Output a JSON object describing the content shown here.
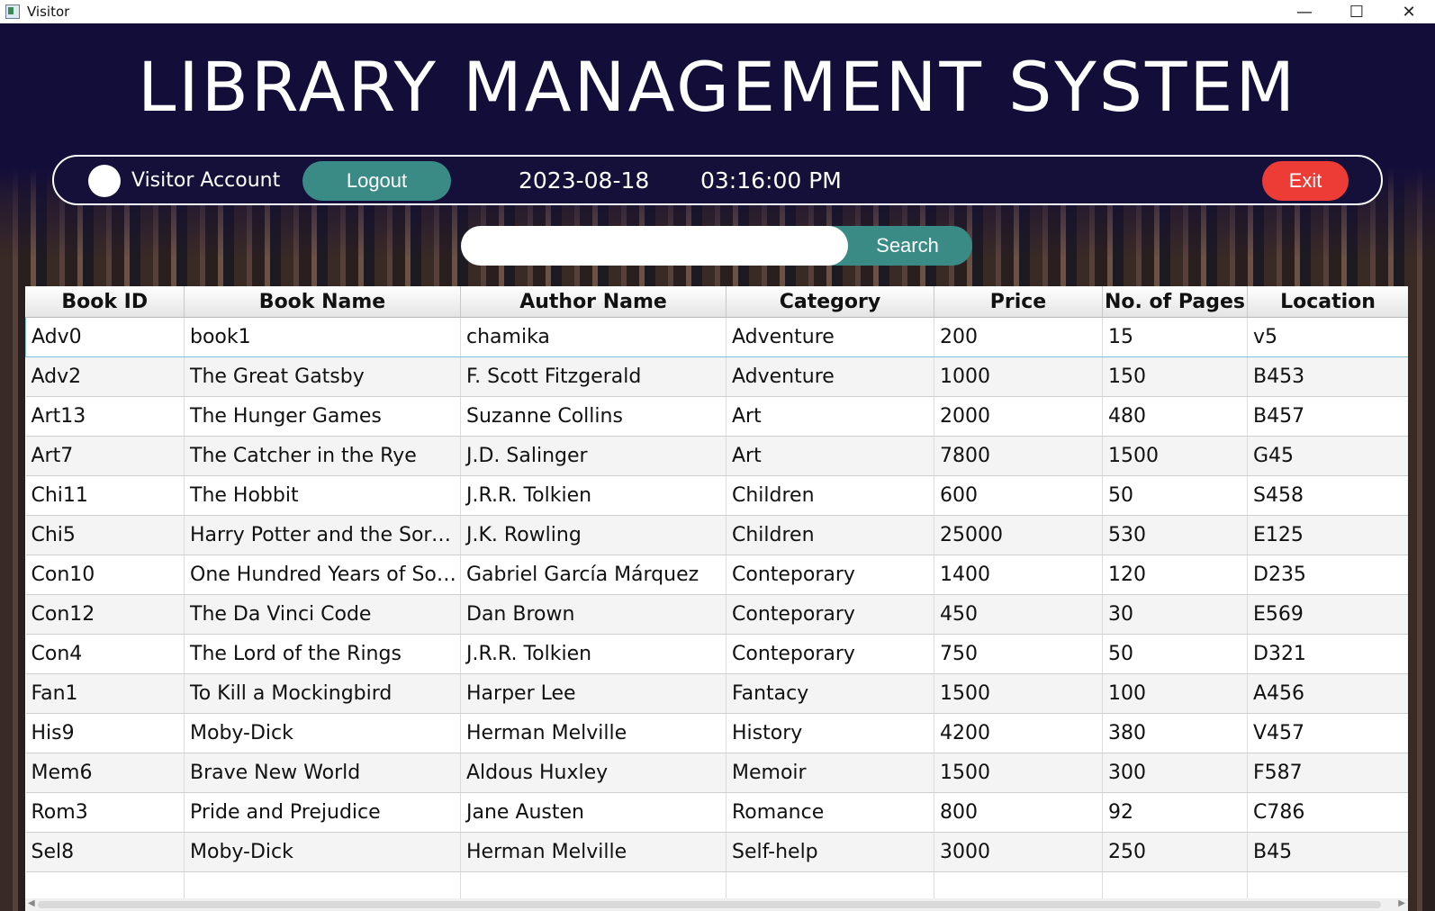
{
  "window": {
    "title": "Visitor",
    "controls": [
      "—",
      "☐",
      "✕"
    ]
  },
  "header": {
    "title": "LIBRARY MANAGEMENT SYSTEM"
  },
  "topbar": {
    "account_label": "Visitor Account",
    "logout_label": "Logout",
    "date": "2023-08-18",
    "time": "03:16:00 PM",
    "exit_label": "Exit"
  },
  "search": {
    "value": "",
    "button_label": "Search"
  },
  "colors": {
    "header_bg": "#15103a",
    "teal": "#3a8b86",
    "exit_red": "#ed3b36"
  },
  "table": {
    "columns": [
      "Book ID",
      "Book Name",
      "Author Name",
      "Category",
      "Price",
      "No. of Pages",
      "Location"
    ],
    "rows": [
      [
        "Adv0",
        "book1",
        "chamika",
        "Adventure",
        "200",
        "15",
        "v5"
      ],
      [
        "Adv2",
        "The Great Gatsby",
        "F. Scott Fitzgerald",
        "Adventure",
        "1000",
        "150",
        "B453"
      ],
      [
        "Art13",
        "The Hunger Games",
        " Suzanne Collins",
        "Art",
        "2000",
        "480",
        "B457"
      ],
      [
        "Art7",
        "The Catcher in the Rye",
        "J.D. Salinger",
        "Art",
        "7800",
        "1500",
        "G45"
      ],
      [
        "Chi11",
        "The Hobbit",
        "J.R.R. Tolkien",
        "Children",
        "600",
        "50",
        "S458"
      ],
      [
        "Chi5",
        "Harry Potter and the Sorcere...",
        "J.K. Rowling",
        "Children",
        "25000",
        "530",
        "E125"
      ],
      [
        "Con10",
        "One Hundred Years of Solitu...",
        "Gabriel García Márquez",
        "Conteporary",
        "1400",
        "120",
        "D235"
      ],
      [
        "Con12",
        "The Da Vinci Code",
        "Dan Brown",
        "Conteporary",
        "450",
        "30",
        "E569"
      ],
      [
        "Con4",
        "The Lord of the Rings",
        "J.R.R. Tolkien",
        "Conteporary",
        "750",
        "50",
        "D321"
      ],
      [
        "Fan1",
        "To Kill a Mockingbird",
        "Harper Lee",
        "Fantacy",
        "1500",
        "100",
        "A456"
      ],
      [
        "His9",
        "Moby-Dick",
        "Herman Melville",
        "History",
        "4200",
        "380",
        "V457"
      ],
      [
        "Mem6",
        "Brave New World",
        "Aldous Huxley",
        "Memoir",
        "1500",
        "300",
        "F587"
      ],
      [
        "Rom3",
        "Pride and Prejudice",
        "Jane Austen",
        "Romance",
        "800",
        "92",
        "C786"
      ],
      [
        "Sel8",
        "Moby-Dick",
        "Herman Melville",
        "Self-help",
        "3000",
        "250",
        "B45"
      ]
    ],
    "selected_row": 0
  }
}
